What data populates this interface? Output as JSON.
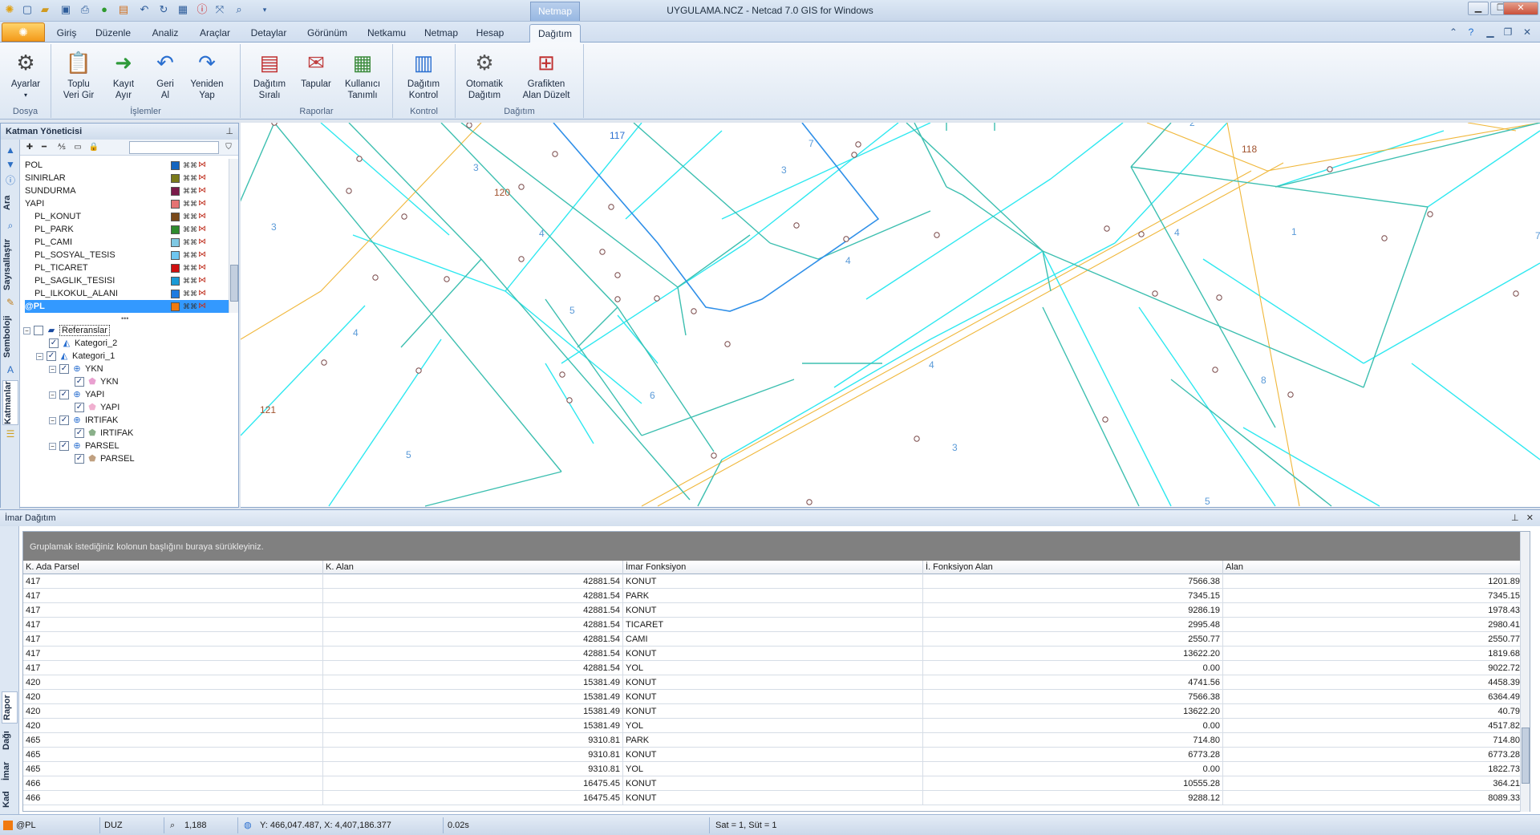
{
  "title": {
    "app_title": "UYGULAMA.NCZ - Netcad 7.0 GIS for Windows",
    "contextual_tab": "Netmap"
  },
  "ribbon": {
    "tabs": [
      "Giriş",
      "Düzenle",
      "Analiz",
      "Araçlar",
      "Detaylar",
      "Görünüm",
      "Netkamu",
      "Netmap",
      "Hesap",
      "Dağıtım"
    ],
    "active_tab": "Dağıtım",
    "groups": {
      "dosya": {
        "title": "Dosya",
        "ayarlar": "Ayarlar"
      },
      "islemler": {
        "title": "İşlemler",
        "toplu": "Toplu\nVeri Gir",
        "kayit": "Kayıt\nAyır",
        "geri": "Geri\nAl",
        "yeniden": "Yeniden\nYap"
      },
      "raporlar": {
        "title": "Raporlar",
        "dagitim_sirali": "Dağıtım\nSıralı",
        "tapular": "Tapular",
        "kullanici": "Kullanıcı\nTanımlı"
      },
      "kontrol": {
        "title": "Kontrol",
        "dagitim_kontrol": "Dağıtım\nKontrol"
      },
      "dagitim": {
        "title": "Dağıtım",
        "otomatik": "Otomatik\nDağıtım",
        "grafikten": "Grafikten\nAlan Düzelt"
      }
    }
  },
  "layer_manager": {
    "title": "Katman Yöneticisi",
    "side_tabs": [
      "Katmanlar",
      "Semboloji",
      "Sayısallaştır",
      "Ara"
    ],
    "layers": [
      {
        "name": "POL",
        "color": "#1565c0"
      },
      {
        "name": "SINIRLAR",
        "color": "#7a7a1a"
      },
      {
        "name": "SUNDURMA",
        "color": "#7a1a4a"
      },
      {
        "name": "YAPI",
        "color": "#e57373"
      },
      {
        "name": "PL_KONUT",
        "color": "#7a4a1a"
      },
      {
        "name": "PL_PARK",
        "color": "#2e8b2e"
      },
      {
        "name": "PL_CAMI",
        "color": "#7ec8e3"
      },
      {
        "name": "PL_SOSYAL_TESIS",
        "color": "#6ec6f0"
      },
      {
        "name": "PL_TICARET",
        "color": "#d01010"
      },
      {
        "name": "PL_SAGLIK_TESISI",
        "color": "#1a9ad6"
      },
      {
        "name": "PL_ILKOKUL_ALANI",
        "color": "#1e7be0"
      },
      {
        "name": "@PL",
        "color": "#f07a10"
      }
    ],
    "tree": {
      "referanslar": "Referanslar",
      "kategori2": "Kategori_2",
      "kategori1": "Kategori_1",
      "ykn": "YKN",
      "yapi": "YAPI",
      "irtifak": "IRTIFAK",
      "parsel": "PARSEL"
    }
  },
  "map": {
    "labels": [
      "117",
      "7",
      "2",
      "118",
      "3",
      "3",
      "120",
      "4",
      "4",
      "3",
      "4",
      "1",
      "7",
      "4",
      "5",
      "8",
      "4",
      "121",
      "5",
      "6",
      "3",
      "5"
    ],
    "colors": {
      "parcel": "#3dbfb0",
      "road": "#2ee8f0",
      "border": "#f0b73a",
      "highlight": "#2f8fe8"
    }
  },
  "imar": {
    "panel_title": "İmar Dağıtım",
    "group_hint": "Gruplamak istediğiniz kolonun başlığını buraya sürükleyiniz.",
    "side_tabs": [
      "Rapor",
      "Dağı",
      "İmar",
      "Kad"
    ],
    "columns": [
      "K. Ada Parsel",
      "K. Alan",
      "İmar Fonksiyon",
      "İ. Fonksiyon Alan",
      "Alan"
    ],
    "rows": [
      [
        "417",
        "42881.54",
        "KONUT",
        "7566.38",
        "1201.89"
      ],
      [
        "417",
        "42881.54",
        "PARK",
        "7345.15",
        "7345.15"
      ],
      [
        "417",
        "42881.54",
        "KONUT",
        "9286.19",
        "1978.43"
      ],
      [
        "417",
        "42881.54",
        "TICARET",
        "2995.48",
        "2980.41"
      ],
      [
        "417",
        "42881.54",
        "CAMI",
        "2550.77",
        "2550.77"
      ],
      [
        "417",
        "42881.54",
        "KONUT",
        "13622.20",
        "1819.68"
      ],
      [
        "417",
        "42881.54",
        "YOL",
        "0.00",
        "9022.72"
      ],
      [
        "420",
        "15381.49",
        "KONUT",
        "4741.56",
        "4458.39"
      ],
      [
        "420",
        "15381.49",
        "KONUT",
        "7566.38",
        "6364.49"
      ],
      [
        "420",
        "15381.49",
        "KONUT",
        "13622.20",
        "40.79"
      ],
      [
        "420",
        "15381.49",
        "YOL",
        "0.00",
        "4517.82"
      ],
      [
        "465",
        "9310.81",
        "PARK",
        "714.80",
        "714.80"
      ],
      [
        "465",
        "9310.81",
        "KONUT",
        "6773.28",
        "6773.28"
      ],
      [
        "465",
        "9310.81",
        "YOL",
        "0.00",
        "1822.73"
      ],
      [
        "466",
        "16475.45",
        "KONUT",
        "10555.28",
        "364.21"
      ],
      [
        "466",
        "16475.45",
        "KONUT",
        "9288.12",
        "8089.33"
      ]
    ]
  },
  "status": {
    "layer": "@PL",
    "mode": "DUZ",
    "zoom": "1,188",
    "coords": "Y: 466,047.487, X: 4,407,186.377",
    "time": "0.02s",
    "cursor": "Sat = 1, Süt = 1"
  }
}
